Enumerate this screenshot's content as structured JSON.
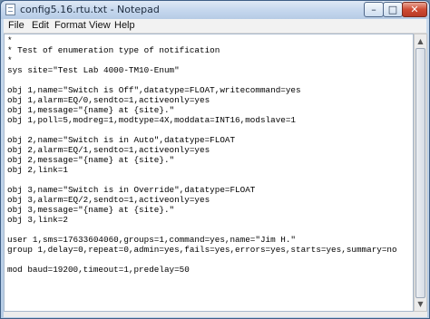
{
  "window": {
    "title": "config5.16.rtu.txt - Notepad",
    "icon": "notepad-icon",
    "controls": {
      "minimize": "–",
      "maximize": "□",
      "close": "✕"
    }
  },
  "menu": [
    "File",
    "Edit",
    "Format",
    "View",
    "Help"
  ],
  "editor": {
    "lines": [
      "*",
      "* Test of enumeration type of notification",
      "*",
      "sys site=\"Test Lab 4000-TM10-Enum\"",
      "",
      "obj 1,name=\"Switch is Off\",datatype=FLOAT,writecommand=yes",
      "obj 1,alarm=EQ/0,sendto=1,activeonly=yes",
      "obj 1,message=\"{name} at {site}.\"",
      "obj 1,poll=5,modreg=1,modtype=4X,moddata=INT16,modslave=1",
      "",
      "obj 2,name=\"Switch is in Auto\",datatype=FLOAT",
      "obj 2,alarm=EQ/1,sendto=1,activeonly=yes",
      "obj 2,message=\"{name} at {site}.\"",
      "obj 2,link=1",
      "",
      "obj 3,name=\"Switch is in Override\",datatype=FLOAT",
      "obj 3,alarm=EQ/2,sendto=1,activeonly=yes",
      "obj 3,message=\"{name} at {site}.\"",
      "obj 3,link=2",
      "",
      "user 1,sms=17633604060,groups=1,command=yes,name=\"Jim H.\"",
      "group 1,delay=0,repeat=0,admin=yes,fails=yes,errors=yes,starts=yes,summary=no",
      "",
      "mod baud=19200,timeout=1,predelay=50"
    ]
  },
  "scrollbar": {
    "up": "▲",
    "down": "▼"
  }
}
